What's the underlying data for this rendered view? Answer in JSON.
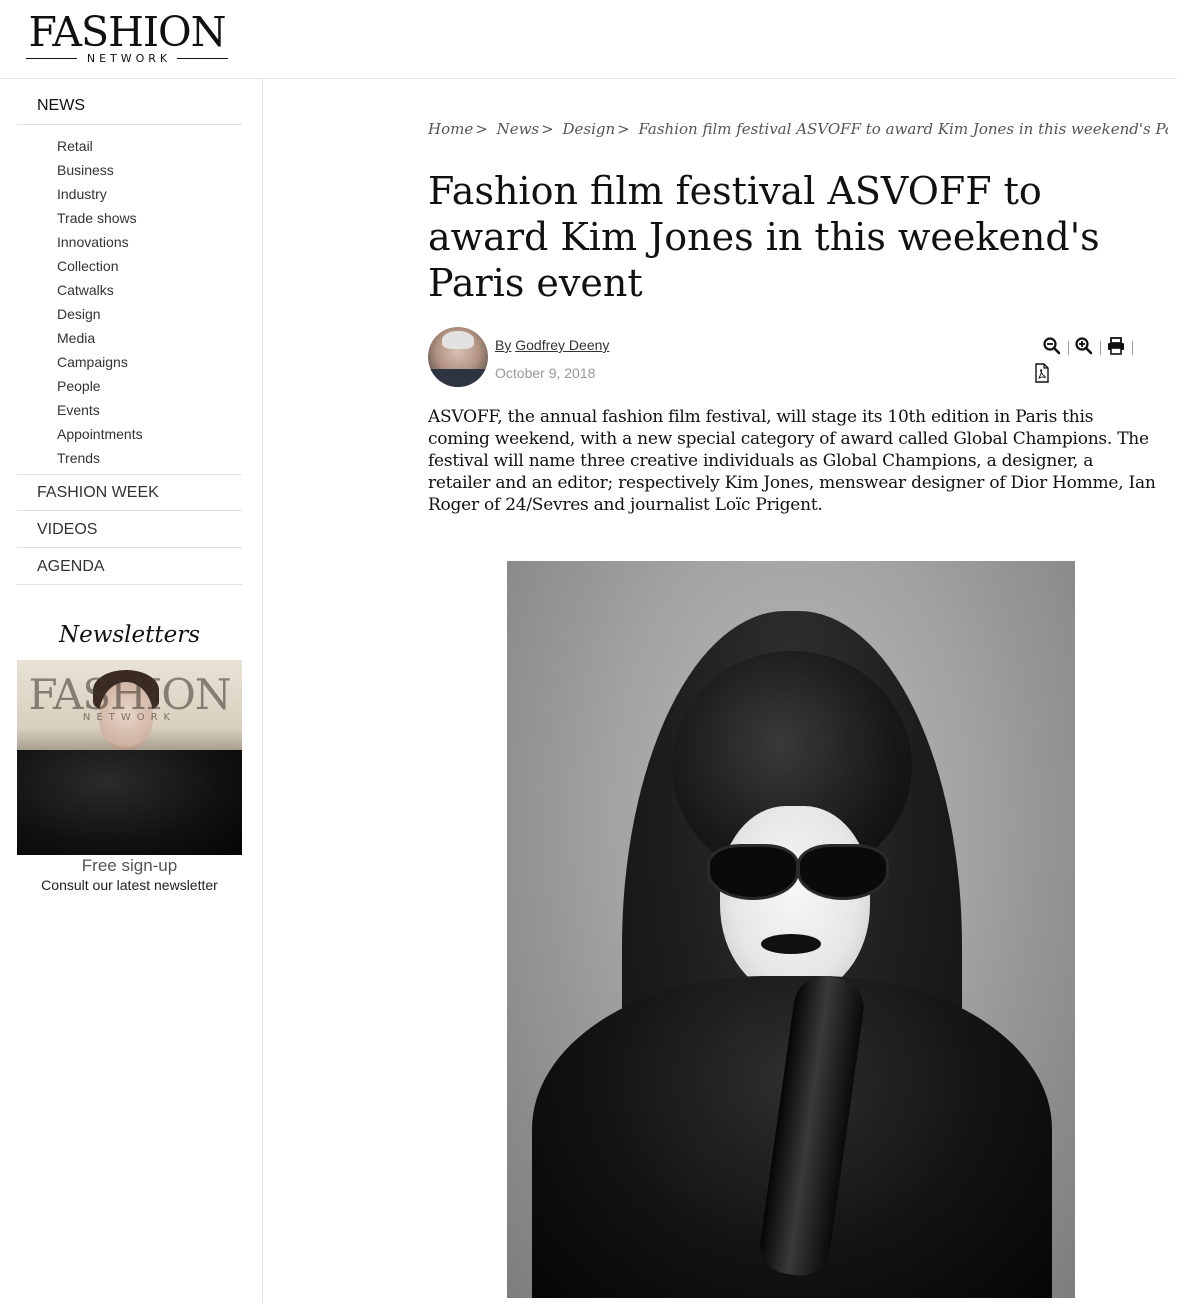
{
  "header": {
    "logo_main": "FASHION",
    "logo_sub": "NETWORK"
  },
  "sidebar": {
    "sections": {
      "news": "NEWS",
      "fashion_week": "FASHION WEEK",
      "videos": "VIDEOS",
      "agenda": "AGENDA"
    },
    "news_items": [
      "Retail",
      "Business",
      "Industry",
      "Trade shows",
      "Innovations",
      "Collection",
      "Catwalks",
      "Design",
      "Media",
      "Campaigns",
      "People",
      "Events",
      "Appointments",
      "Trends"
    ],
    "newsletter": {
      "title": "Newsletters",
      "image_logo_main": "FASHION",
      "image_logo_sub": "NETWORK",
      "cta": "Free sign-up",
      "subtitle": "Consult our latest newsletter"
    }
  },
  "breadcrumb": {
    "items": [
      "Home",
      "News",
      "Design"
    ],
    "current": "Fashion film festival ASVOFF to award Kim Jones in this weekend's Paris ...",
    "separator": ">"
  },
  "article": {
    "title": "Fashion film festival ASVOFF to award Kim Jones in this weekend's Paris event",
    "byline_prefix": "By",
    "author": "Godfrey Deeny",
    "date": "October 9, 2018",
    "lead": "ASVOFF, the annual fashion film festival, will stage its 10th edition in Paris this coming weekend, with a new special category of award called Global Champions. The festival will name three creative individuals as Global Champions, a designer, a retailer and an editor; respectively Kim Jones, menswear designer of Dior Homme, Ian Roger of 24/Sevres and journalist Loïc Prigent."
  },
  "tools": {
    "icons": [
      "zoom-out-icon",
      "zoom-in-icon",
      "print-icon",
      "pdf-icon"
    ]
  },
  "colors": {
    "text": "#111111",
    "muted": "#999999",
    "divider": "#e3e3e3"
  }
}
